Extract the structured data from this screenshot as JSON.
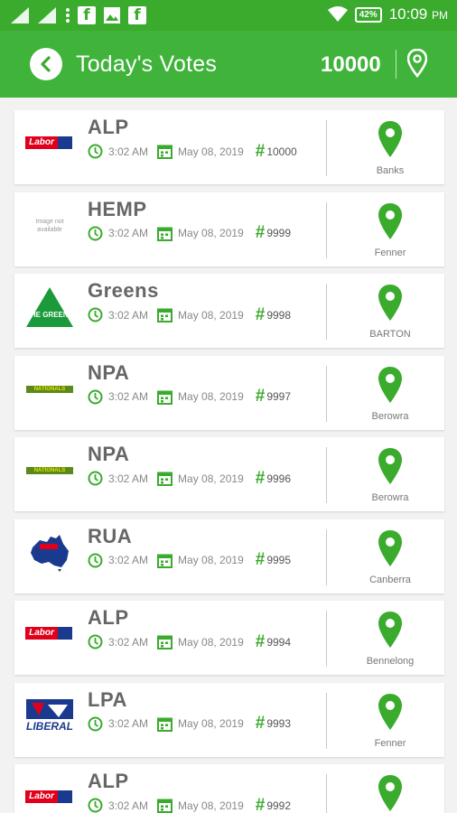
{
  "status_bar": {
    "battery": "42%",
    "time": "10:09",
    "ampm": "PM",
    "icons": [
      "signal-icon",
      "signal-icon",
      "more-vert-icon",
      "facebook-icon",
      "image-icon",
      "facebook-icon",
      "wifi-icon",
      "battery-icon"
    ]
  },
  "header": {
    "title": "Today's Votes",
    "count": "10000"
  },
  "colors": {
    "primary": "#3fb33a",
    "accent": "#3aab2d"
  },
  "logo_text": {
    "labor": "Labor",
    "image_not_available": "Image not available",
    "greens": "THE GREENS",
    "nationals": "NATIONALS",
    "liberal": "LIBERAL"
  },
  "votes": [
    {
      "party": "ALP",
      "logo": "labor",
      "time": "3:02 AM",
      "date": "May 08, 2019",
      "number": "10000",
      "location": "Banks"
    },
    {
      "party": "HEMP",
      "logo": "none",
      "time": "3:02 AM",
      "date": "May 08, 2019",
      "number": "9999",
      "location": "Fenner"
    },
    {
      "party": "Greens",
      "logo": "greens",
      "time": "3:02 AM",
      "date": "May 08, 2019",
      "number": "9998",
      "location": "BARTON"
    },
    {
      "party": "NPA",
      "logo": "nationals",
      "time": "3:02 AM",
      "date": "May 08, 2019",
      "number": "9997",
      "location": "Berowra"
    },
    {
      "party": "NPA",
      "logo": "nationals",
      "time": "3:02 AM",
      "date": "May 08, 2019",
      "number": "9996",
      "location": "Berowra"
    },
    {
      "party": "RUA",
      "logo": "rua",
      "time": "3:02 AM",
      "date": "May 08, 2019",
      "number": "9995",
      "location": "Canberra"
    },
    {
      "party": "ALP",
      "logo": "labor",
      "time": "3:02 AM",
      "date": "May 08, 2019",
      "number": "9994",
      "location": "Bennelong"
    },
    {
      "party": "LPA",
      "logo": "liberal",
      "time": "3:02 AM",
      "date": "May 08, 2019",
      "number": "9993",
      "location": "Fenner"
    },
    {
      "party": "ALP",
      "logo": "labor",
      "time": "3:02 AM",
      "date": "May 08, 2019",
      "number": "9992",
      "location": ""
    }
  ]
}
